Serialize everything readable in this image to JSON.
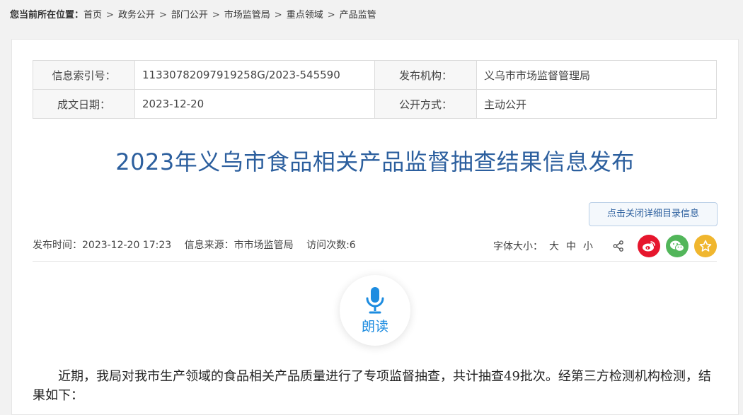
{
  "breadcrumb": {
    "lead": "您当前所在位置：",
    "items": [
      "首页",
      "政务公开",
      "部门公开",
      "市场监管局",
      "重点领域",
      "产品监管"
    ],
    "separator": ">"
  },
  "meta": {
    "index_label": "信息索引号：",
    "index_value": "11330782097919258G/2023-545590",
    "publisher_label": "发布机构：",
    "publisher_value": "义乌市市场监督管理局",
    "date_label": "成文日期：",
    "date_value": "2023-12-20",
    "mode_label": "公开方式：",
    "mode_value": "主动公开"
  },
  "title": "2023年义乌市食品相关产品监督抽查结果信息发布",
  "toggle_button": "点击关闭详细目录信息",
  "info": {
    "publish_time": "发布时间：2023-12-20 17:23",
    "source": "信息来源：市市场监管局",
    "visits": "访问次数:6"
  },
  "font_size": {
    "label": "字体大小：",
    "large": "大",
    "medium": "中",
    "small": "小"
  },
  "share": {
    "icons": [
      "share-icon",
      "weibo-icon",
      "wechat-icon",
      "favorite-icon"
    ],
    "colors": {
      "weibo": "#e6162d",
      "wechat": "#52b65a",
      "favorite": "#f0b62e"
    }
  },
  "read_aloud": {
    "label": "朗读",
    "icon": "microphone-icon"
  },
  "body": {
    "paragraph1": "近期，我局对我市生产领域的食品相关产品质量进行了专项监督抽查，共计抽查49批次。经第三方检测机构检测，结果如下："
  },
  "colors": {
    "title": "#2c5f9e",
    "accent": "#1d8ce0"
  }
}
